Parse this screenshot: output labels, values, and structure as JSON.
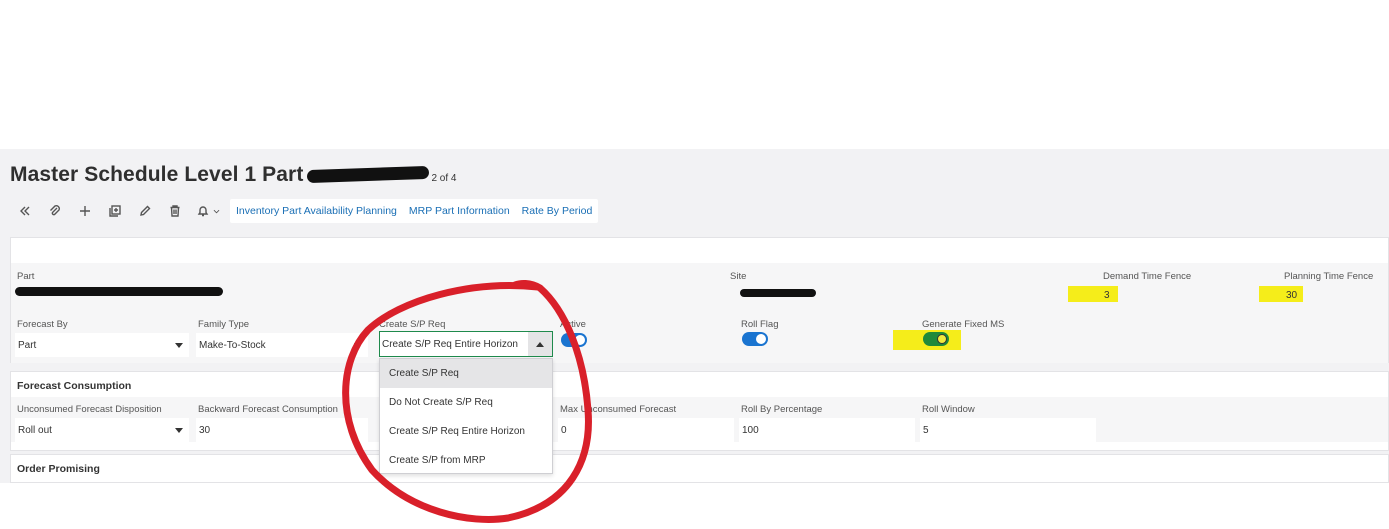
{
  "header": {
    "title": "Master Schedule Level 1 Part",
    "record_count": "2 of 4"
  },
  "toolbar": {
    "icons": [
      "collapse-icon",
      "attachment-icon",
      "add-icon",
      "duplicate-icon",
      "edit-icon",
      "delete-icon",
      "bell-icon"
    ],
    "links": [
      "Inventory Part Availability Planning",
      "MRP Part Information",
      "Rate By Period"
    ]
  },
  "main": {
    "part_label": "Part",
    "site_label": "Site",
    "demand_time_fence_label": "Demand Time Fence",
    "demand_time_fence_value": "3",
    "planning_time_fence_label": "Planning Time Fence",
    "planning_time_fence_value": "30",
    "forecast_by_label": "Forecast By",
    "forecast_by_value": "Part",
    "family_type_label": "Family Type",
    "family_type_value": "Make-To-Stock",
    "create_sp_req_label": "Create S/P Req",
    "create_sp_req_value": "Create S/P Req Entire Horizon",
    "active_label": "Active",
    "roll_flag_label": "Roll Flag",
    "generate_fixed_ms_label": "Generate Fixed MS"
  },
  "dropdown": {
    "options": [
      "Create S/P Req",
      "Do Not Create S/P Req",
      "Create S/P Req Entire Horizon",
      "Create S/P from MRP"
    ]
  },
  "forecast_consumption": {
    "title": "Forecast Consumption",
    "unconsumed_label": "Unconsumed Forecast Disposition",
    "unconsumed_value": "Roll out",
    "backward_label": "Backward Forecast Consumption",
    "backward_value": "30",
    "max_unconsumed_label": "Max Unconsumed Forecast",
    "max_unconsumed_value": "0",
    "roll_by_percentage_label": "Roll By Percentage",
    "roll_by_percentage_value": "100",
    "roll_window_label": "Roll Window",
    "roll_window_value": "5"
  },
  "order_promising": {
    "title": "Order Promising"
  },
  "colors": {
    "link": "#1a6fb5",
    "toggle_on": "#1a74d0",
    "toggle_green": "#1f8a3a",
    "highlight": "#f5ed1a",
    "annotation_red": "#d9202a"
  }
}
